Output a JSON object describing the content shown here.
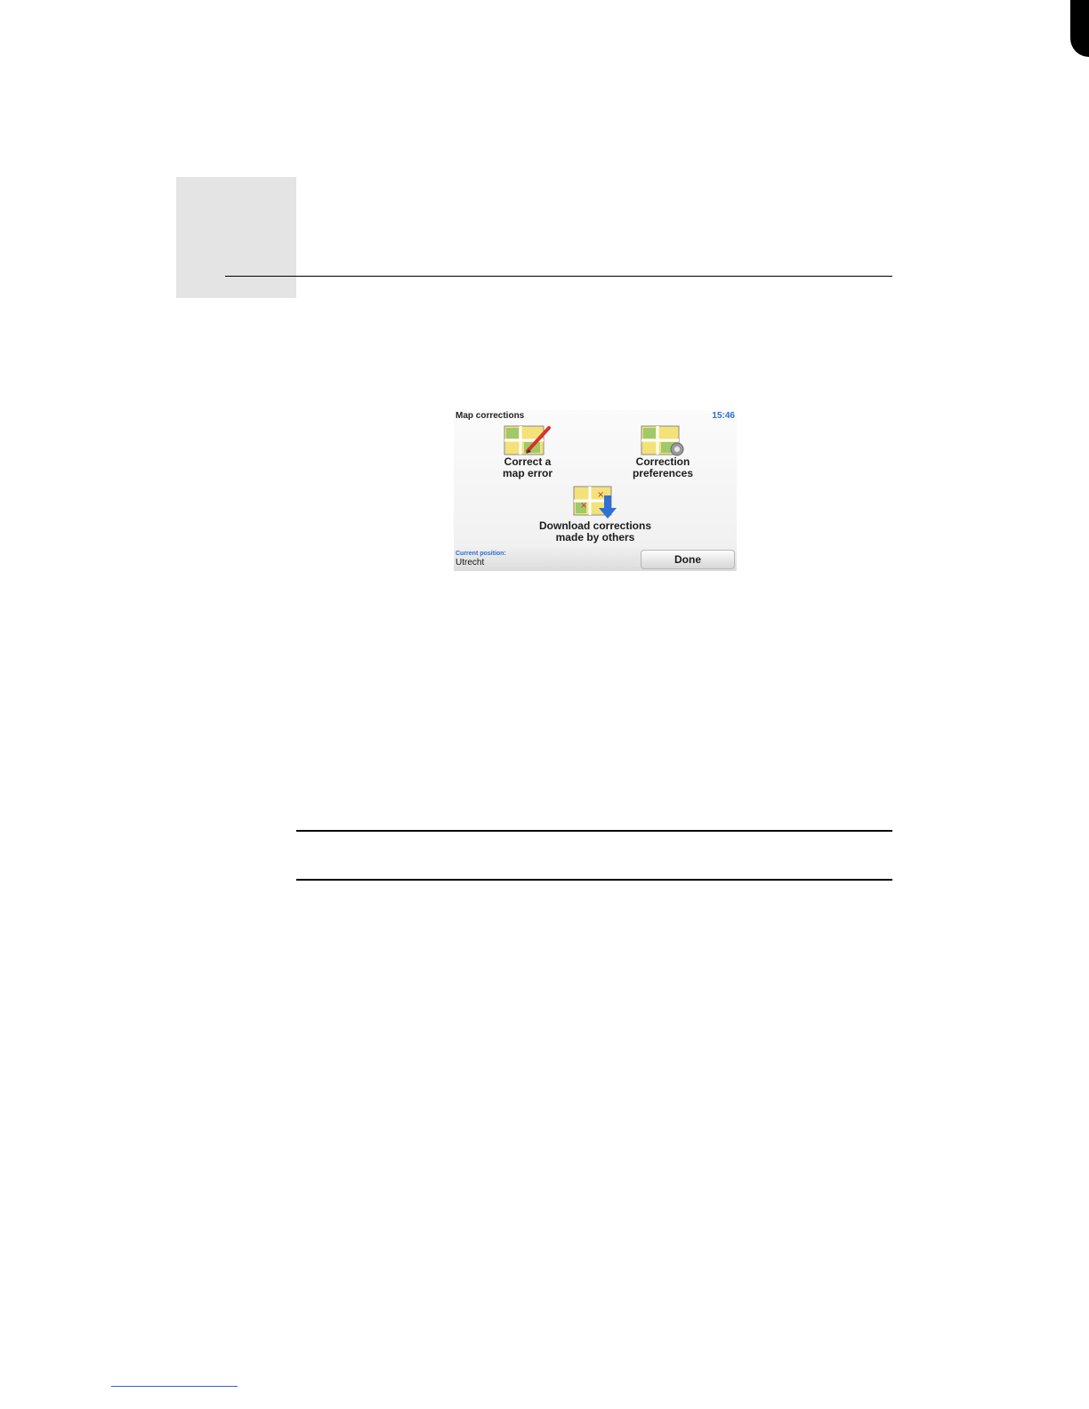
{
  "screen": {
    "title": "Map corrections",
    "time": "15:46",
    "menu": {
      "correct_error": "Correct a\nmap error",
      "preferences": "Correction\npreferences",
      "download": "Download corrections\nmade by others"
    },
    "position_label": "Current position:",
    "position_value": "Utrecht",
    "done_label": "Done"
  },
  "colors": {
    "accent": "#2a6fd0",
    "map_green": "#9fc96a",
    "map_yellow": "#f3e27a",
    "pencil_red": "#d8332a",
    "arrow_blue": "#2f6fd6"
  }
}
